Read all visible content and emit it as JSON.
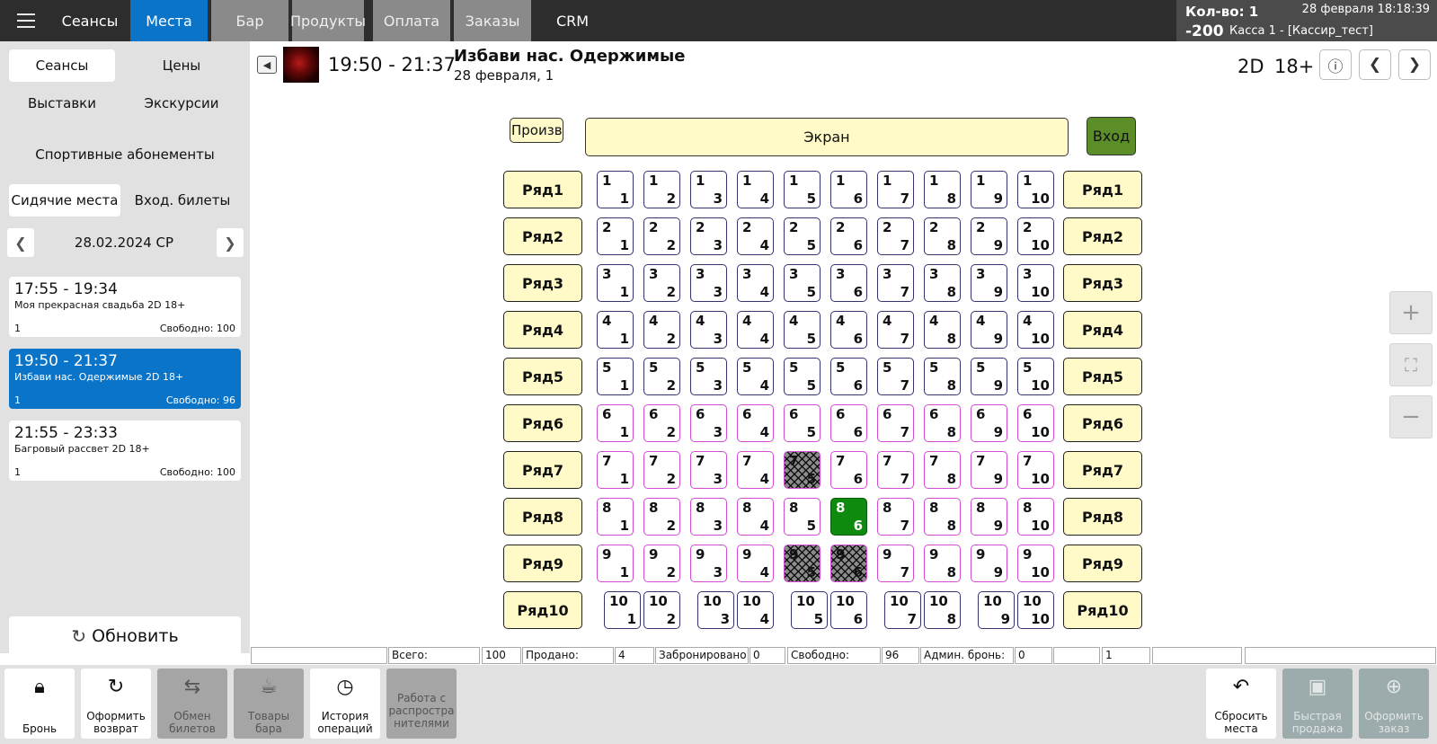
{
  "topbar": {
    "tabs": [
      {
        "label": "Сеансы"
      },
      {
        "label": "Места"
      },
      {
        "label": "Бар"
      },
      {
        "label": "Продукты"
      },
      {
        "label": "Оплата"
      },
      {
        "label": "Заказы"
      },
      {
        "label": "CRM"
      }
    ],
    "active_tab": "Места",
    "qty": "Кол-во: 1",
    "sum": "-200",
    "datetime": "28 февраля 18:18:39",
    "cashier": "Касса 1 - [Кассир_тест]"
  },
  "left": {
    "buttons": {
      "sessions": "Сеансы",
      "prices": "Цены",
      "exhibitions": "Выставки",
      "excursions": "Экскурсии",
      "sport": "Спортивные абонементы",
      "seating": "Сидячие места",
      "entry": "Вход. билеты"
    },
    "date": "28.02.2024 СР",
    "sessions": [
      {
        "time": "17:55 - 19:34",
        "title": "Моя прекрасная свадьба 2D 18+",
        "hall": "1",
        "free": "Свободно: 100"
      },
      {
        "time": "19:50 - 21:37",
        "title": "Избави нас. Одержимые 2D 18+",
        "hall": "1",
        "free": "Свободно: 96"
      },
      {
        "time": "21:55 - 23:33",
        "title": "Багровый рассвет 2D 18+",
        "hall": "1",
        "free": "Свободно: 100"
      }
    ],
    "refresh": "Обновить"
  },
  "header": {
    "time_range": "19:50 - 21:37",
    "title": "Избави нас. Одержимые",
    "subtitle": "28 февраля, 1",
    "format": "2D",
    "age": "18+"
  },
  "hall": {
    "prod_label": "Производство",
    "screen": "Экран",
    "entrance": "Вход",
    "row_labels": [
      "Ряд1",
      "Ряд2",
      "Ряд3",
      "Ряд4",
      "Ряд5",
      "Ряд6",
      "Ряд7",
      "Ряд8",
      "Ряд9",
      "Ряд10"
    ],
    "rows": 10,
    "seats_per_row": 10,
    "pink_rows_from": 6,
    "sold": [
      [
        7,
        5
      ],
      [
        9,
        5
      ],
      [
        9,
        6
      ]
    ],
    "selected": [
      [
        8,
        6
      ]
    ],
    "colors": {
      "screen": "#fffac8",
      "entrance": "#5b8d28",
      "selected": "#0e8a0e",
      "seat_border": "#33336e",
      "seat_border_pink": "#d24bd2"
    }
  },
  "stats": {
    "total_label": "Всего:",
    "total": "100",
    "sold_label": "Продано:",
    "sold": "4",
    "booked_label": "Забронировано",
    "booked": "0",
    "free_label": "Свободно:",
    "free": "96",
    "admin_label": "Админ. бронь:",
    "admin": "0",
    "extra": "1"
  },
  "toolbar": {
    "book": "Бронь",
    "refund": "Оформить\nвозврат",
    "exchange": "Обмен\nбилетов",
    "bar_goods": "Товары\nбара",
    "history": "История\nопераций",
    "distributors": "Работа с\nраспростра\nнителями",
    "reset": "Сбросить\nместа",
    "quick_sale": "Быстрая\nпродажа",
    "make_order": "Оформить\nзаказ"
  },
  "icons": {
    "menu": "hamburger-icon",
    "lock": "lock-icon",
    "refund": "refresh-icon",
    "exchange": "swap-arrows-icon",
    "bar": "burger-drink-icon",
    "history": "clock-icon",
    "reset": "undo-arrow-icon",
    "quick_sale": "cash-icon",
    "order": "cart-plus-icon"
  }
}
